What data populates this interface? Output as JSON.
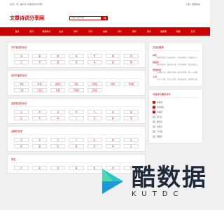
{
  "topbar": {
    "left_text": "古诗、词、曲分享 文章诗词分享网",
    "right_text": "订阅 | 收藏本站"
  },
  "header": {
    "logo": "文章诗词分享网",
    "search_placeholder": "请输入搜索内容"
  },
  "nav": [
    "首页",
    "唐代",
    "两晋南北",
    "先秦",
    "宋代",
    "元代",
    "金朝",
    "清代",
    "明代",
    "现代",
    "魏晋南",
    "隋朝",
    "五代"
  ],
  "sections": [
    {
      "title": "天气相关的诗词",
      "tags": [
        "春",
        "夏",
        "秋",
        "冬",
        "雪",
        "雨",
        "风",
        "云",
        "月",
        "露",
        "雷",
        "电",
        "霜",
        "雾"
      ]
    },
    {
      "title": "诗词作者的诗词",
      "tags": [
        "李白",
        "杜甫",
        "白居易",
        "苏轼",
        "辛弃疾",
        "陆游",
        "李清照",
        "王维",
        "王安石",
        "杜牧",
        "李商隐",
        "孟浩然"
      ]
    },
    {
      "title": "品质相关的诗词",
      "tags": [
        "山",
        "水",
        "花",
        "草",
        "鸟",
        "鱼",
        "虫",
        "松",
        "竹",
        "梅",
        "兰",
        "菊",
        "柳",
        "荷"
      ]
    },
    {
      "title": "诗歌的诗词",
      "tags": [
        "忠",
        "孝",
        "仁",
        "义",
        "礼",
        "智",
        "信",
        "勇",
        "廉",
        "耻",
        "勤",
        "俭",
        "恭",
        "让"
      ]
    },
    {
      "title": "思念",
      "tags": [
        "乡",
        "家",
        "友",
        "情",
        "爱",
        "思",
        "念"
      ]
    }
  ],
  "side": {
    "recommend_title": "古诗词推荐",
    "items": [
      {
        "title": "春晓",
        "desc": "春眠不觉晓，处处闻啼鸟。夜来风雨声，花落知多少。"
      },
      {
        "title": "静夜思",
        "desc": "床前明月光，疑是地上霜。举头望明月，低头思故乡。"
      },
      {
        "title": "登鹳雀楼",
        "desc": "白日依山尽，黄河入海流。欲穷千里目，更上一层楼。"
      },
      {
        "title": "江雪",
        "desc": "千山鸟飞绝，万径人踪灭。孤舟蓑笠翁，独钓寒江雪。"
      }
    ],
    "rank_title": "可能感兴趣的诗词",
    "rank": [
      "将进酒",
      "水调歌头",
      "念奴娇",
      "满江红",
      "蝶恋花",
      "如梦令",
      "声声慢",
      "雨霖铃"
    ]
  },
  "watermark": {
    "cn": "酷数据",
    "en": "KUTDC"
  }
}
